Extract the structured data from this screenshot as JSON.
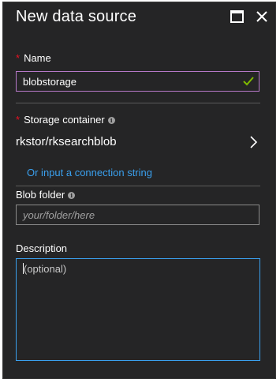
{
  "header": {
    "title": "New data source"
  },
  "name_field": {
    "label": "Name",
    "required_marker": "*",
    "value": "blobstorage",
    "valid": true
  },
  "storage_container": {
    "label": "Storage container",
    "required_marker": "*",
    "value": "rkstor/rksearchblob",
    "connection_link": "Or input a connection string"
  },
  "blob_folder": {
    "label": "Blob folder",
    "placeholder": "your/folder/here"
  },
  "description": {
    "label": "Description",
    "placeholder": "(optional)"
  },
  "icons": {
    "maximize": "maximize-icon",
    "close": "close-icon",
    "check": "check-icon",
    "info": "info-icon",
    "chevron": "chevron-right-icon"
  },
  "colors": {
    "panel_bg": "#252526",
    "required": "#e81123",
    "link": "#3aa0ee",
    "valid_check": "#7fba00",
    "focus_border": "#3aa0ee",
    "name_border": "#b678c8"
  }
}
